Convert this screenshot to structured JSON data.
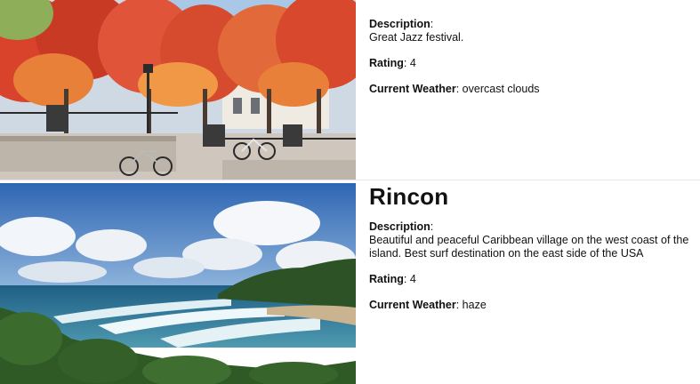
{
  "cards": [
    {
      "title": "",
      "description_label": "Description",
      "description": "Great Jazz festival.",
      "rating_label": "Rating",
      "rating": "4",
      "weather_label": "Current Weather",
      "weather": "overcast clouds"
    },
    {
      "title": "Rincon",
      "description_label": "Description",
      "description": "Beautiful and peaceful Caribbean village on the west coast of the island. Best surf destination on the east side of the USA",
      "rating_label": "Rating",
      "rating": "4",
      "weather_label": "Current Weather",
      "weather": "haze"
    }
  ],
  "colors": {
    "autumn_red": "#d9432b",
    "autumn_orange": "#e8803a",
    "sky_blue": "#3d7ac4",
    "sea_blue": "#2f6f8f",
    "foliage_green": "#2f5a26"
  }
}
